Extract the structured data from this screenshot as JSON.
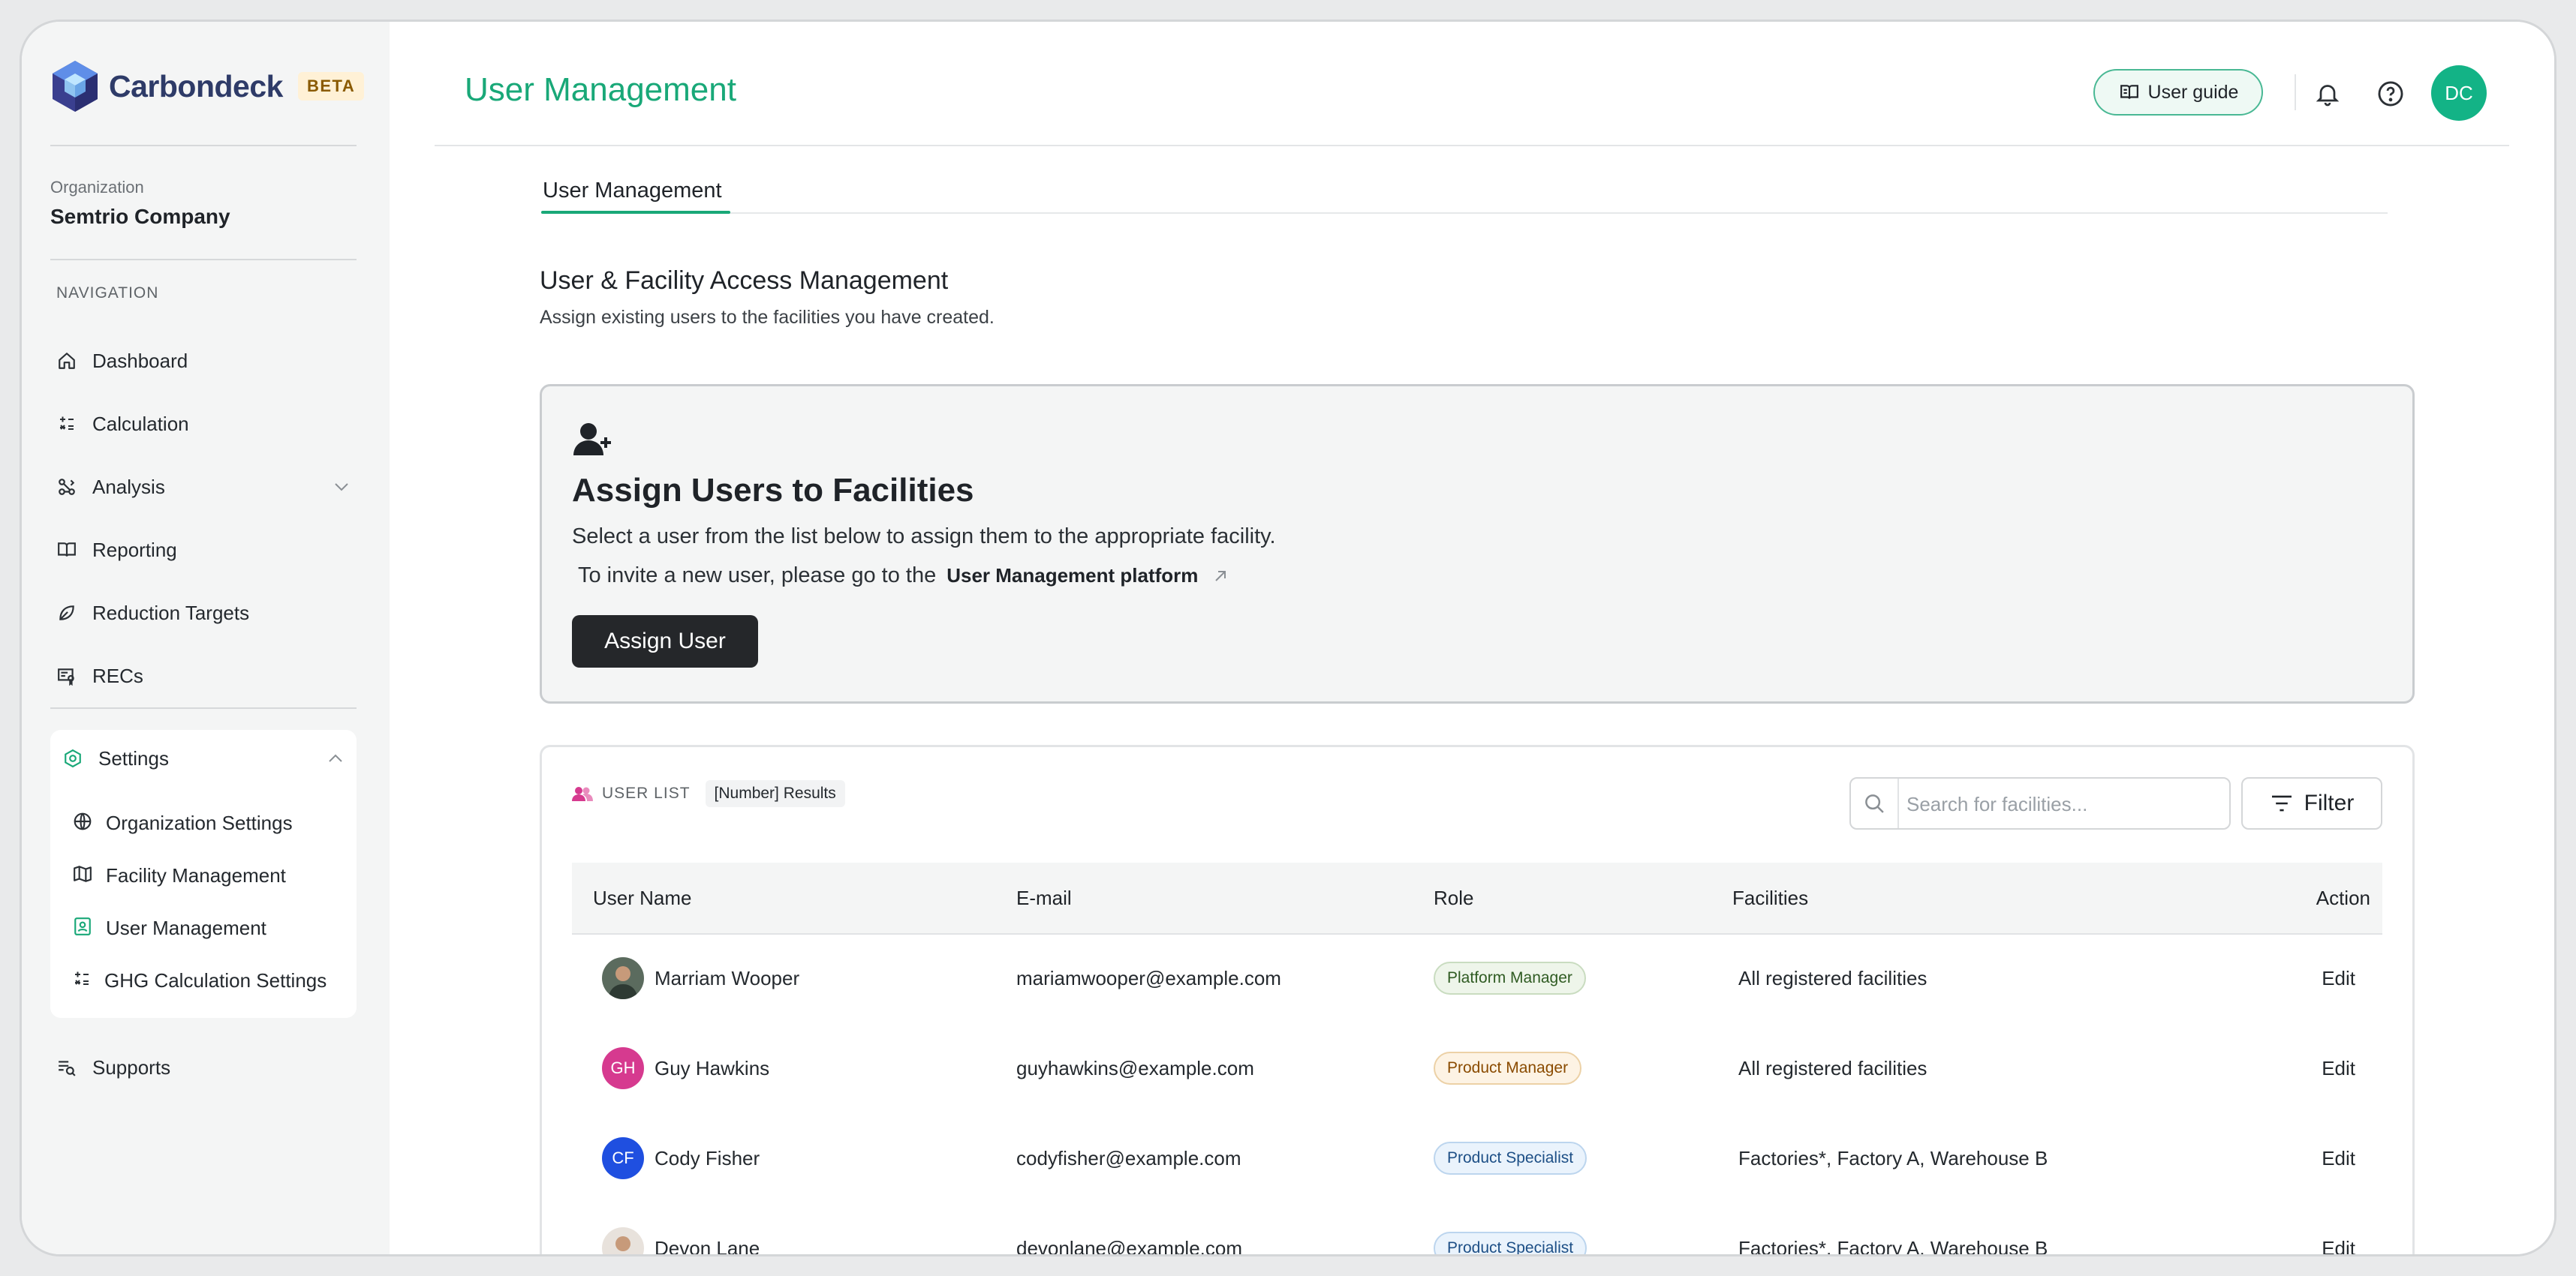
{
  "brand": {
    "name": "Carbondeck",
    "badge": "BETA"
  },
  "organization": {
    "label": "Organization",
    "name": "Semtrio Company"
  },
  "nav": {
    "label": "NAVIGATION",
    "items": [
      {
        "label": "Dashboard",
        "icon": "home-icon"
      },
      {
        "label": "Calculation",
        "icon": "calculator-icon"
      },
      {
        "label": "Analysis",
        "icon": "analysis-icon"
      },
      {
        "label": "Reporting",
        "icon": "book-icon"
      },
      {
        "label": "Reduction Targets",
        "icon": "leaf-icon"
      },
      {
        "label": "RECs",
        "icon": "certificate-icon"
      }
    ],
    "settings": {
      "label": "Settings",
      "items": [
        {
          "label": "Organization Settings",
          "icon": "globe-icon"
        },
        {
          "label": "Facility Management",
          "icon": "map-icon"
        },
        {
          "label": "User Management",
          "icon": "user-badge-icon"
        },
        {
          "label": "GHG Calculation Settings",
          "icon": "calculator-icon"
        }
      ]
    },
    "supports": {
      "label": "Supports",
      "icon": "support-icon"
    }
  },
  "header": {
    "title": "User Management",
    "user_guide": "User guide",
    "avatar_initials": "DC",
    "accent": "#19a878"
  },
  "tabs": [
    {
      "label": "User Management"
    }
  ],
  "section": {
    "title": "User & Facility Access Management",
    "description": "Assign existing users to the facilities you have created."
  },
  "assign_card": {
    "title": "Assign Users to Facilities",
    "line1": "Select a user from the list below to assign them to the appropriate facility.",
    "line2": "To invite a new user, please go to the",
    "link": "User Management platform",
    "button": "Assign User"
  },
  "user_list": {
    "label": "USER LIST",
    "count": "[Number] Results",
    "search_placeholder": "Search for facilities...",
    "filter": "Filter",
    "columns": [
      "User Name",
      "E-mail",
      "Role",
      "Facilities",
      "Action"
    ],
    "rows": [
      {
        "name": "Marriam Wooper",
        "email": "mariamwooper@example.com",
        "role": "Platform Manager",
        "facilities": "All registered facilities",
        "action": "Edit",
        "avatar": "photo",
        "initials": "",
        "avatar_color": "#5b6b5e",
        "badge": {
          "bg": "#eef5ea",
          "border": "#c9dcc0",
          "color": "#2f5b22"
        }
      },
      {
        "name": "Guy Hawkins",
        "email": "guyhawkins@example.com",
        "role": "Product Manager",
        "facilities": "All registered facilities",
        "action": "Edit",
        "avatar": "initials",
        "initials": "GH",
        "avatar_color": "#d63a8f",
        "badge": {
          "bg": "#fdf3e4",
          "border": "#ecd1a6",
          "color": "#8a4b00"
        }
      },
      {
        "name": "Cody Fisher",
        "email": "codyfisher@example.com",
        "role": "Product Specialist",
        "facilities": "Factories*, Factory A, Warehouse B",
        "action": "Edit",
        "avatar": "initials",
        "initials": "CF",
        "avatar_color": "#1f4fe0",
        "badge": {
          "bg": "#eaf3fc",
          "border": "#bcd5ee",
          "color": "#1d4f86"
        }
      },
      {
        "name": "Devon Lane",
        "email": "devonlane@example.com",
        "role": "Product Specialist",
        "facilities": "Factories*, Factory A, Warehouse B",
        "action": "Edit",
        "avatar": "photo",
        "initials": "",
        "avatar_color": "#e8e2dc",
        "badge": {
          "bg": "#eaf3fc",
          "border": "#bcd5ee",
          "color": "#1d4f86"
        }
      }
    ]
  }
}
